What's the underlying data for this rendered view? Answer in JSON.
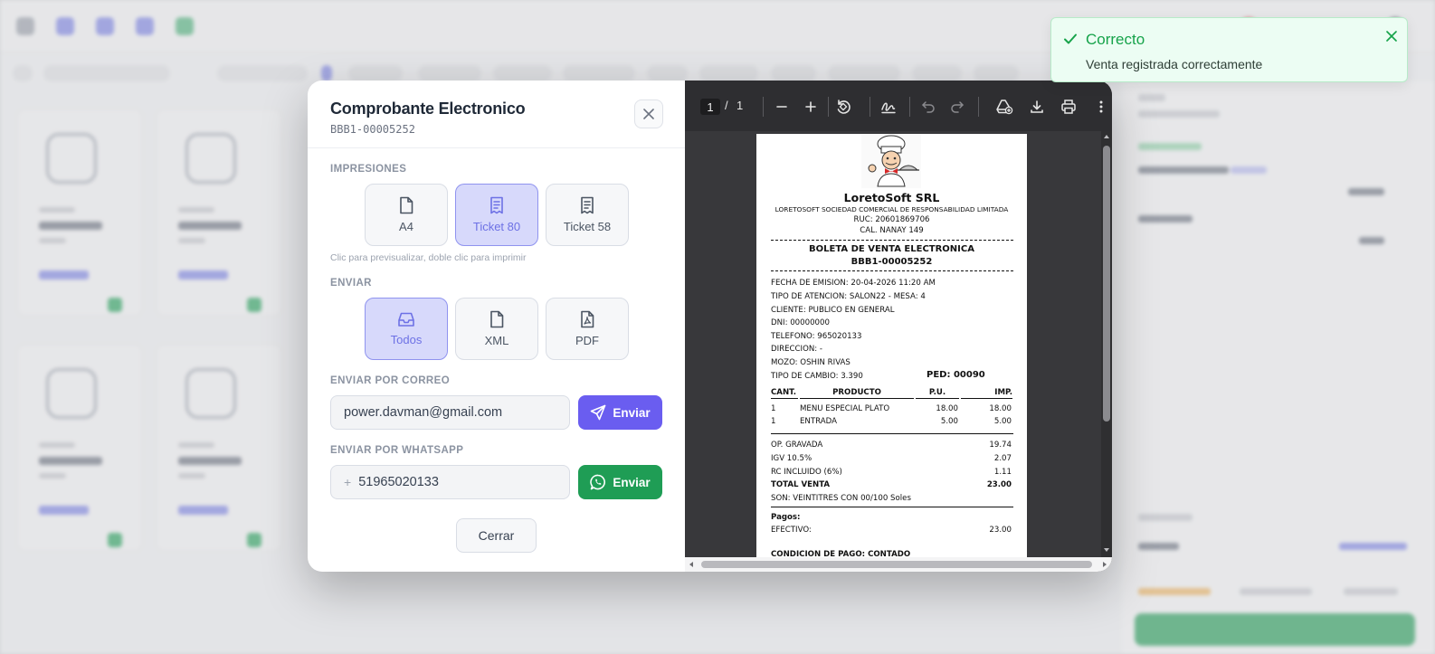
{
  "modal": {
    "title": "Comprobante Electronico",
    "doc_number": "BBB1-00005252",
    "impresiones": {
      "label": "IMPRESIONES",
      "options": [
        "A4",
        "Ticket 80",
        "Ticket 58"
      ],
      "selected": "Ticket 80",
      "hint": "Clic para previsualizar, doble clic para imprimir"
    },
    "enviar": {
      "label": "ENVIAR",
      "options": [
        "Todos",
        "XML",
        "PDF"
      ],
      "selected": "Todos"
    },
    "correo": {
      "label": "ENVIAR POR CORREO",
      "value": "power.davman@gmail.com",
      "button": "Enviar"
    },
    "whatsapp": {
      "label": "ENVIAR POR WHATSAPP",
      "prefix": "+",
      "value": "51965020133",
      "button": "Enviar"
    },
    "close_button": "Cerrar"
  },
  "viewer": {
    "page_current": "1",
    "page_separator": "/",
    "page_total": "1"
  },
  "receipt": {
    "company": "LoretoSoft SRL",
    "legal_name": "LORETOSOFT SOCIEDAD COMERCIAL DE RESPONSABILIDAD LIMITADA",
    "ruc": "RUC: 20601869706",
    "address": "CAL. NANAY 149",
    "doc_type": "BOLETA DE VENTA ELECTRONICA",
    "doc_number": "BBB1-00005252",
    "fecha": "FECHA DE EMISION: 20-04-2026 11:20 AM",
    "tipo_atencion": "TIPO DE ATENCION: SALON22 - MESA: 4",
    "cliente": "CLIENTE: PUBLICO EN GENERAL",
    "dni": "DNI: 00000000",
    "telefono": "TELEFONO: 965020133",
    "direccion": "DIRECCION: -",
    "mozo": "MOZO: OSHIN RIVAS",
    "tipo_cambio": "TIPO DE CAMBIO: 3.390",
    "pedido": "PED: 00090",
    "headers": {
      "cant": "CANT.",
      "producto": "PRODUCTO",
      "pu": "P.U.",
      "imp": "IMP."
    },
    "items": [
      {
        "cant": "1",
        "producto": "MENU ESPECIAL PLATO",
        "pu": "18.00",
        "imp": "18.00"
      },
      {
        "cant": "1",
        "producto": "ENTRADA",
        "pu": "5.00",
        "imp": "5.00"
      }
    ],
    "totals": [
      {
        "label": "OP. GRAVADA",
        "value": "19.74",
        "bold": false
      },
      {
        "label": "IGV 10.5%",
        "value": "2.07",
        "bold": false
      },
      {
        "label": "RC INCLUIDO (6%)",
        "value": "1.11",
        "bold": false
      },
      {
        "label": "TOTAL VENTA",
        "value": "23.00",
        "bold": true
      }
    ],
    "son": "SON: VEINTITRES CON 00/100 Soles",
    "pagos_label": "Pagos:",
    "pago_metodo": "EFECTIVO:",
    "pago_monto": "23.00",
    "condicion": "CONDICION DE PAGO: CONTADO"
  },
  "toast": {
    "title": "Correcto",
    "message": "Venta registrada correctamente",
    "color": "#16a34a"
  },
  "colors": {
    "accent": "#6d71e5",
    "send_mail": "#6a5df0",
    "whatsapp": "#1f9d55"
  }
}
